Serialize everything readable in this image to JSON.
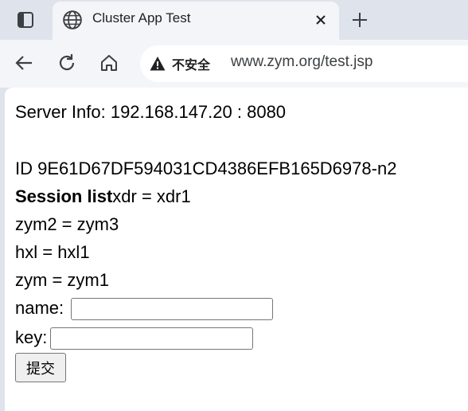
{
  "browser": {
    "tab": {
      "title": "Cluster App Test"
    },
    "address_bar": {
      "security_label": "不安全",
      "url": "www.zym.org/test.jsp"
    }
  },
  "page": {
    "server_info": "Server Info: 192.168.147.20 : 8080",
    "session_id": "ID 9E61D67DF594031CD4386EFB165D6978-n2",
    "session_list_label": "Session list",
    "session_items": [
      "xdr = xdr1",
      "zym2 = zym3",
      "hxl = hxl1",
      "zym = zym1"
    ],
    "form": {
      "name_label": "name:",
      "name_value": "",
      "key_label": "key:",
      "key_value": "",
      "submit_label": "提交"
    }
  }
}
